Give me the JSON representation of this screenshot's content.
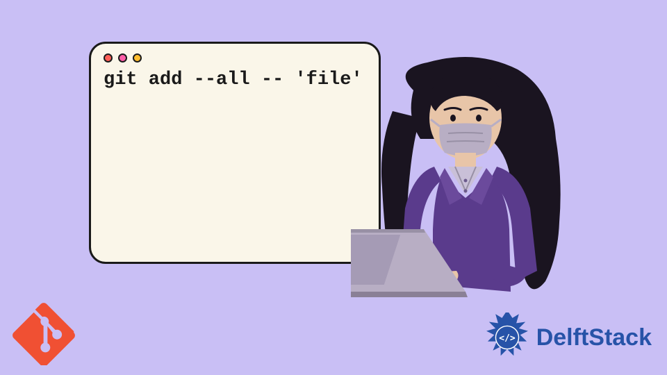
{
  "terminal": {
    "command": "git add --all -- 'file'"
  },
  "brand": {
    "name": "DelftStack"
  },
  "colors": {
    "background": "#c9bff5",
    "terminal_bg": "#faf6e9",
    "terminal_border": "#1a1a1a",
    "git_orange": "#f05033",
    "delft_blue": "#2753a8",
    "jacket": "#5a3b8c",
    "laptop": "#b8aec4",
    "skin": "#e8c5a8",
    "hair": "#1a1420"
  },
  "icons": {
    "git": "git-logo",
    "delft_badge": "delft-badge"
  }
}
